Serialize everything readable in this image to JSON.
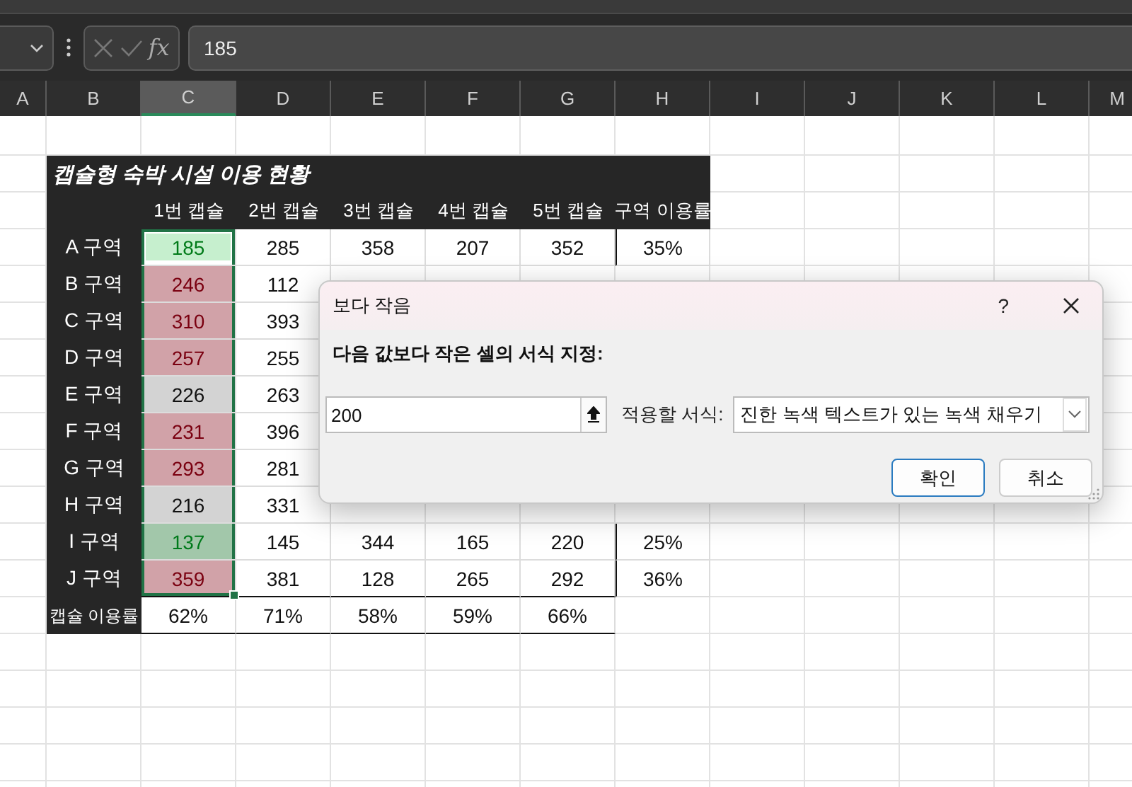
{
  "formula_bar": {
    "function_label": "fx",
    "value": "185"
  },
  "column_headers": [
    {
      "label": "A",
      "selected": false
    },
    {
      "label": "B",
      "selected": false
    },
    {
      "label": "C",
      "selected": true
    },
    {
      "label": "D",
      "selected": false
    },
    {
      "label": "E",
      "selected": false
    },
    {
      "label": "F",
      "selected": false
    },
    {
      "label": "G",
      "selected": false
    },
    {
      "label": "H",
      "selected": false
    },
    {
      "label": "I",
      "selected": false
    },
    {
      "label": "J",
      "selected": false
    },
    {
      "label": "K",
      "selected": false
    },
    {
      "label": "L",
      "selected": false
    },
    {
      "label": "M",
      "selected": false
    }
  ],
  "table": {
    "title": "캡슐형 숙박 시설 이용 현황",
    "columns": [
      "1번 캡슐",
      "2번 캡슐",
      "3번 캡슐",
      "4번 캡슐",
      "5번 캡슐",
      "구역 이용률"
    ],
    "rows": [
      {
        "label": "A 구역",
        "cells": [
          {
            "value": "185",
            "color": "#c6efce",
            "active": true
          },
          {
            "value": "285"
          },
          {
            "value": "358"
          },
          {
            "value": "207"
          },
          {
            "value": "352"
          },
          {
            "value": "35%"
          }
        ]
      },
      {
        "label": "B 구역",
        "cells": [
          {
            "value": "246",
            "color": "#d1a2a8"
          },
          {
            "value": "112"
          },
          null,
          null,
          null,
          null
        ]
      },
      {
        "label": "C 구역",
        "cells": [
          {
            "value": "310",
            "color": "#d1a2a8"
          },
          {
            "value": "393"
          },
          null,
          null,
          null,
          null
        ]
      },
      {
        "label": "D 구역",
        "cells": [
          {
            "value": "257",
            "color": "#d1a2a8"
          },
          {
            "value": "255"
          },
          null,
          null,
          null,
          null
        ]
      },
      {
        "label": "E 구역",
        "cells": [
          {
            "value": "226",
            "active": false
          },
          {
            "value": "263"
          },
          null,
          null,
          null,
          null
        ]
      },
      {
        "label": "F 구역",
        "cells": [
          {
            "value": "231",
            "color": "#d1a2a8"
          },
          {
            "value": "396"
          },
          null,
          null,
          null,
          null
        ]
      },
      {
        "label": "G 구역",
        "cells": [
          {
            "value": "293",
            "color": "#d1a2a8"
          },
          {
            "value": "281"
          },
          null,
          null,
          null,
          null
        ]
      },
      {
        "label": "H 구역",
        "cells": [
          {
            "value": "216",
            "active": false
          },
          {
            "value": "331"
          },
          null,
          null,
          null,
          null
        ]
      },
      {
        "label": "I 구역",
        "cells": [
          {
            "value": "137",
            "color": "#a2c7aa"
          },
          {
            "value": "145"
          },
          {
            "value": "344"
          },
          {
            "value": "165"
          },
          {
            "value": "220"
          },
          {
            "value": "25%"
          }
        ]
      },
      {
        "label": "J 구역",
        "cells": [
          {
            "value": "359",
            "color": "#d1a2a8"
          },
          {
            "value": "381"
          },
          {
            "value": "128"
          },
          {
            "value": "265"
          },
          {
            "value": "292"
          },
          {
            "value": "36%"
          }
        ]
      }
    ],
    "totals": {
      "label": "캡슐 이용률",
      "values": [
        "62%",
        "71%",
        "58%",
        "59%",
        "66%"
      ]
    }
  },
  "dialog": {
    "title": "보다 작음",
    "help": "?",
    "prompt": "다음 값보다 작은 셀의 서식 지정:",
    "value": "200",
    "format_label": "적용할 서식:",
    "format": "진한 녹색 텍스트가 있는 녹색 채우기",
    "buttons": [
      {
        "label": "확인",
        "default": true
      },
      {
        "label": "취소",
        "default": false
      }
    ]
  }
}
